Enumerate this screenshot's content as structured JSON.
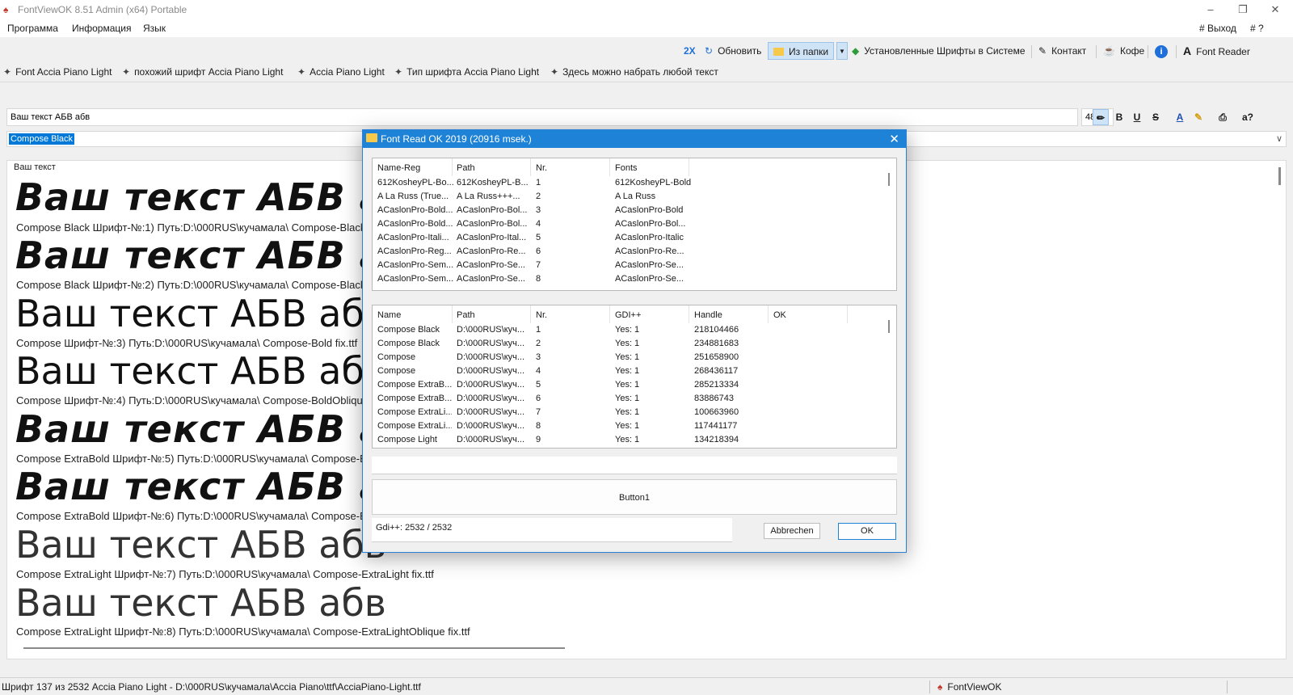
{
  "window": {
    "title": "FontViewOK 8.51 Admin (x64) Portable"
  },
  "menu": {
    "items": [
      "Программа",
      "Информация",
      "Язык"
    ],
    "exit": "# Выход",
    "help": "# ?"
  },
  "toolbar": {
    "zoom": "2X",
    "refresh": "Обновить",
    "from_folder": "Из папки",
    "installed_fonts": "Установленные Шрифты в Системе",
    "contact": "Контакт",
    "coffee": "Кофе",
    "font_reader": "Font Reader"
  },
  "tabs": [
    "Font Accia Piano Light",
    "похожий шрифт  Accia Piano Light",
    "Accia Piano Light",
    "Тип шрифта  Accia Piano Light",
    "Здесь можно набрать любой текст"
  ],
  "editor": {
    "text": "Ваш текст АБВ абв",
    "size": "48",
    "font": "Compose Black"
  },
  "formatting": {
    "bold": "B",
    "underline": "U",
    "strike": "S",
    "text_color": "A",
    "help": "a?"
  },
  "preview": {
    "header": "Ваш текст",
    "samples": [
      {
        "text": "Ваш текст АБВ абв",
        "caption": "Compose Black Шрифт-№:1) Путь:D:\\000RUS\\кучамала\\ Compose-Black fix.ttf"
      },
      {
        "text": "Ваш текст АБВ абв",
        "caption": "Compose Black Шрифт-№:2) Путь:D:\\000RUS\\кучамала\\ Compose-BlackOblique fix.ttf"
      },
      {
        "text": "Ваш текст АБВ абв",
        "caption": "Compose Шрифт-№:3) Путь:D:\\000RUS\\кучамала\\ Compose-Bold fix.ttf"
      },
      {
        "text": "Ваш текст АБВ абв",
        "caption": "Compose Шрифт-№:4) Путь:D:\\000RUS\\кучамала\\ Compose-BoldOblique fix.ttf"
      },
      {
        "text": "Ваш текст АБВ абв",
        "caption": "Compose ExtraBold Шрифт-№:5) Путь:D:\\000RUS\\кучамала\\ Compose-ExtraBold fix.ttf"
      },
      {
        "text": "Ваш текст АБВ абв",
        "caption": "Compose ExtraBold Шрифт-№:6) Путь:D:\\000RUS\\кучамала\\ Compose-ExtraBoldOblique fix.ttf"
      },
      {
        "text": "Ваш текст АБВ абв",
        "caption": "Compose ExtraLight Шрифт-№:7) Путь:D:\\000RUS\\кучамала\\ Compose-ExtraLight fix.ttf"
      },
      {
        "text": "Ваш текст АБВ абв",
        "caption": "Compose ExtraLight Шрифт-№:8) Путь:D:\\000RUS\\кучамала\\ Compose-ExtraLightOblique fix.ttf"
      }
    ]
  },
  "status": {
    "text": "Шрифт 137 из 2532 Accia Piano Light - D:\\000RUS\\кучамала\\Accia Piano\\ttf\\AcciaPiano-Light.ttf",
    "app": "FontViewOK"
  },
  "dialog": {
    "title": "Font Read OK 2019 (20916 msek.)",
    "list1": {
      "columns": [
        "Name-Reg",
        "Path",
        "Nr.",
        "Fonts"
      ],
      "rows": [
        [
          "612KosheyPL-Bo...",
          "612KosheyPL-B...",
          "1",
          "612KosheyPL-Bold"
        ],
        [
          "A La Russ (True...",
          "A La Russ+++...",
          "2",
          "A La Russ"
        ],
        [
          "ACaslonPro-Bold...",
          "ACaslonPro-Bol...",
          "3",
          "ACaslonPro-Bold"
        ],
        [
          "ACaslonPro-Bold...",
          "ACaslonPro-Bol...",
          "4",
          "ACaslonPro-Bol..."
        ],
        [
          "ACaslonPro-Itali...",
          "ACaslonPro-Ital...",
          "5",
          "ACaslonPro-Italic"
        ],
        [
          "ACaslonPro-Reg...",
          "ACaslonPro-Re...",
          "6",
          "ACaslonPro-Re..."
        ],
        [
          "ACaslonPro-Sem...",
          "ACaslonPro-Se...",
          "7",
          "ACaslonPro-Se..."
        ],
        [
          "ACaslonPro-Sem...",
          "ACaslonPro-Se...",
          "8",
          "ACaslonPro-Se..."
        ]
      ]
    },
    "list2": {
      "columns": [
        "Name",
        "Path",
        "Nr.",
        "GDI++",
        "Handle",
        "OK"
      ],
      "rows": [
        [
          "Compose Black",
          "D:\\000RUS\\куч...",
          "1",
          "Yes: 1",
          "218104466",
          ""
        ],
        [
          "Compose Black",
          "D:\\000RUS\\куч...",
          "2",
          "Yes: 1",
          "234881683",
          ""
        ],
        [
          "Compose",
          "D:\\000RUS\\куч...",
          "3",
          "Yes: 1",
          "251658900",
          ""
        ],
        [
          "Compose",
          "D:\\000RUS\\куч...",
          "4",
          "Yes: 1",
          "268436117",
          ""
        ],
        [
          "Compose ExtraB...",
          "D:\\000RUS\\куч...",
          "5",
          "Yes: 1",
          "285213334",
          ""
        ],
        [
          "Compose ExtraB...",
          "D:\\000RUS\\куч...",
          "6",
          "Yes: 1",
          "83886743",
          ""
        ],
        [
          "Compose ExtraLi...",
          "D:\\000RUS\\куч...",
          "7",
          "Yes: 1",
          "100663960",
          ""
        ],
        [
          "Compose ExtraLi...",
          "D:\\000RUS\\куч...",
          "8",
          "Yes: 1",
          "117441177",
          ""
        ],
        [
          "Compose Light",
          "D:\\000RUS\\куч...",
          "9",
          "Yes: 1",
          "134218394",
          ""
        ]
      ]
    },
    "button1": "Button1",
    "gdi_status": "Gdi++: 2532 / 2532",
    "cancel": "Abbrechen",
    "ok": "OK"
  },
  "colors": {
    "accent": "#1e83d6",
    "selection": "#0078d7",
    "folder_button": "#cfe3f7"
  },
  "icons": [
    "refresh-icon",
    "folder-icon",
    "installed-fonts-icon",
    "contact-icon",
    "coffee-icon",
    "info-icon",
    "font-reader-icon",
    "tab-icon",
    "pen-icon",
    "highlighter-icon",
    "print-icon"
  ]
}
